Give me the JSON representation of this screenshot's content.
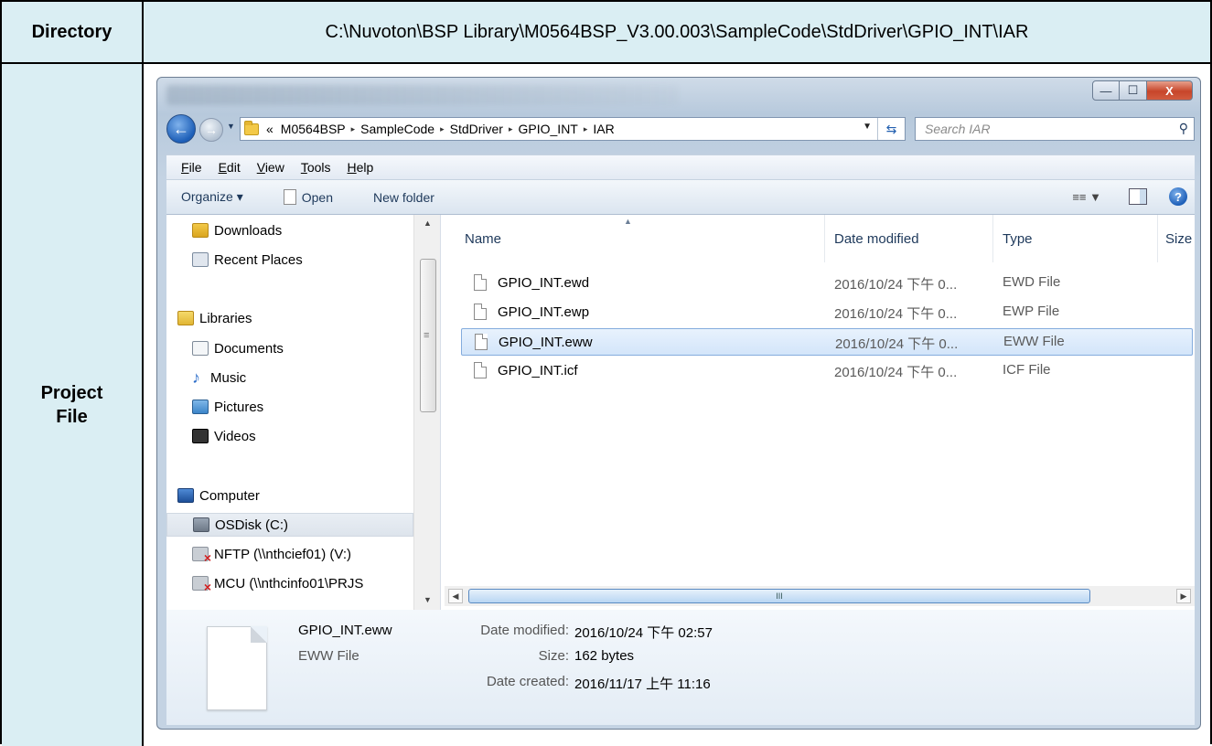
{
  "table": {
    "directory_label": "Directory",
    "directory_value": "C:\\Nuvoton\\BSP Library\\M0564BSP_V3.00.003\\SampleCode\\StdDriver\\GPIO_INT\\IAR",
    "project_label_line1": "Project",
    "project_label_line2": "File"
  },
  "window": {
    "caption_buttons": {
      "minimize": "—",
      "maximize": "☐",
      "close": "X"
    },
    "address": {
      "prefix": "«",
      "segments": [
        "M0564BSP",
        "SampleCode",
        "StdDriver",
        "GPIO_INT",
        "IAR"
      ],
      "separator": "▸"
    },
    "search_placeholder": "Search IAR",
    "menu": [
      "File",
      "Edit",
      "View",
      "Tools",
      "Help"
    ],
    "menu_underline": [
      "F",
      "E",
      "V",
      "T",
      "H"
    ],
    "command_bar": {
      "organize": "Organize ▾",
      "open": "Open",
      "new_folder": "New folder"
    },
    "nav": {
      "items": [
        {
          "label": "Downloads",
          "icon": "downloads-icon"
        },
        {
          "label": "Recent Places",
          "icon": "recent-places-icon"
        },
        {
          "label": "Libraries",
          "icon": "libraries-icon"
        },
        {
          "label": "Documents",
          "icon": "documents-icon"
        },
        {
          "label": "Music",
          "icon": "music-icon"
        },
        {
          "label": "Pictures",
          "icon": "pictures-icon"
        },
        {
          "label": "Videos",
          "icon": "videos-icon"
        },
        {
          "label": "Computer",
          "icon": "computer-icon"
        },
        {
          "label": "OSDisk (C:)",
          "icon": "disk-icon"
        },
        {
          "label": "NFTP (\\\\nthcief01) (V:)",
          "icon": "network-drive-icon"
        },
        {
          "label": "MCU (\\\\nthcinfo01\\PRJS",
          "icon": "network-drive-icon"
        }
      ]
    },
    "columns": {
      "name": "Name",
      "date": "Date modified",
      "type": "Type",
      "size": "Size"
    },
    "files": [
      {
        "name": "GPIO_INT.ewd",
        "date": "2016/10/24 下午 0...",
        "type": "EWD File",
        "selected": false
      },
      {
        "name": "GPIO_INT.ewp",
        "date": "2016/10/24 下午 0...",
        "type": "EWP File",
        "selected": false
      },
      {
        "name": "GPIO_INT.eww",
        "date": "2016/10/24 下午 0...",
        "type": "EWW File",
        "selected": true
      },
      {
        "name": "GPIO_INT.icf",
        "date": "2016/10/24 下午 0...",
        "type": "ICF File",
        "selected": false
      }
    ],
    "hscroll_grip": "III",
    "details": {
      "name": "GPIO_INT.eww",
      "type": "EWW File",
      "date_modified_label": "Date modified:",
      "date_modified_value": "2016/10/24 下午 02:57",
      "size_label": "Size:",
      "size_value": "162 bytes",
      "date_created_label": "Date created:",
      "date_created_value": "2016/11/17 上午 11:16"
    }
  },
  "colors": {
    "table_header_bg": "#daeef3",
    "selection_border": "#84acdd"
  }
}
